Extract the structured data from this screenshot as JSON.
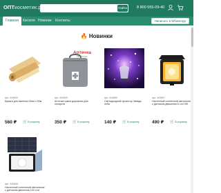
{
  "header": {
    "logo_main": "ОПТ",
    "logo_rest": "косметик.рф",
    "search_placeholder": "",
    "search_button": "Найти",
    "phone": "8 800 555-09-40"
  },
  "nav": {
    "items": [
      {
        "label": "Главная",
        "active": true
      },
      {
        "label": "Каталог",
        "active": false
      },
      {
        "label": "Новинки",
        "active": false
      },
      {
        "label": "Контакты",
        "active": false
      }
    ],
    "whatsapp": "Написать в WhatsApp"
  },
  "section": {
    "title": "Новинки",
    "icon": "fire-icon"
  },
  "colors": {
    "brand": "#1f7a5f",
    "nav": "#2d8d6f",
    "accent_fire": "#e86a1c",
    "logo_apteka": "#d9342b"
  },
  "products": [
    {
      "sku": "арт. 349820",
      "name": "Бумага для выпечки 30см x 50м",
      "price": "560 ₽",
      "cart": "В корзину",
      "image": "baking-paper-roll-image"
    },
    {
      "sku": "арт. 349839",
      "name": "Аптечка сумка дорожная для лекарств",
      "price": "350 ₽",
      "cart": "В корзину",
      "image": "first-aid-bag-image",
      "logo_text": "Аптечка",
      "logo_sub": "Multicolor"
    },
    {
      "sku": "арт. 349890",
      "name": "Светодиодный проектор Звезды неба",
      "price": "140 ₽",
      "cart": "В корзину",
      "image": "star-projector-image"
    },
    {
      "sku": "арт. 349897",
      "name": "Настенный солнечный светильник с датчиком движения 8 Led 9W",
      "price": "490 ₽",
      "cart": "В корзину",
      "image": "solar-wall-lamp-image"
    },
    {
      "sku": "арт. 349898",
      "name": "Настенный солнечный светильник с датчиком движения 100 Led",
      "price": "",
      "cart": "",
      "image": "solar-floodlight-image"
    }
  ]
}
